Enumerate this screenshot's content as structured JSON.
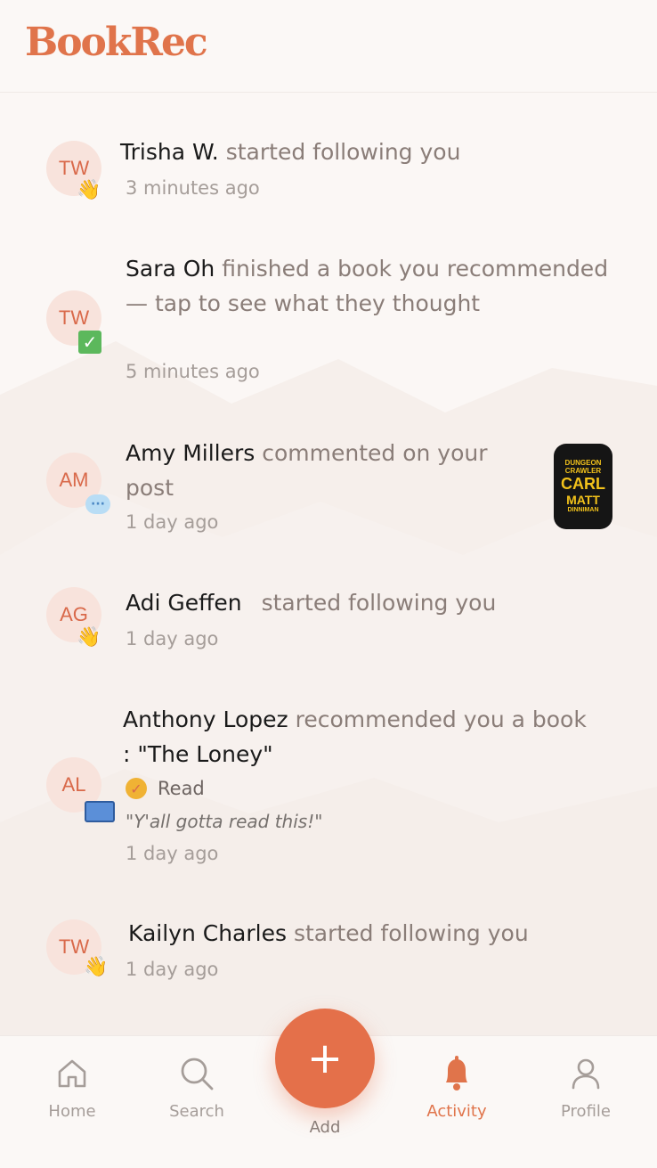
{
  "app": {
    "logo": "BookRec"
  },
  "colors": {
    "accent": "#e0744b",
    "background": "#fbf7f5",
    "avatar_bg": "#f8e3dc"
  },
  "activity": [
    {
      "initials": "TW",
      "badge": "wave-icon",
      "name": "Trisha W.",
      "action": "started following you",
      "time": "3 minutes ago"
    },
    {
      "initials": "TW",
      "badge": "check-icon",
      "name": "Sara Oh",
      "action": "finished a book you recommended — tap to see what they thought",
      "time": "5 minutes ago"
    },
    {
      "initials": "AM",
      "badge": "comment-icon",
      "name": "Amy Millers",
      "action": "commented on your post",
      "time": "1 day ago",
      "book_cover": {
        "line1": "DUNGEON CRAWLER",
        "line2": "CARL",
        "line3": "MATT",
        "line4": "DINNIMAN"
      }
    },
    {
      "initials": "AG",
      "badge": "wave-icon",
      "name": "Adi Geffen",
      "action": "started following you",
      "time": "1 day ago"
    },
    {
      "initials": "AL",
      "badge": "book-icon",
      "name": "Anthony Lopez",
      "action": "recommended you a book",
      "book_title": ": \"The Loney\"",
      "status": "Read",
      "quote": "\"Y'all gotta read this!\"",
      "time": "1 day ago"
    },
    {
      "initials": "TW",
      "badge": "wave-icon",
      "name": "Kailyn Charles",
      "action": "started following you",
      "time": "1 day ago"
    }
  ],
  "nav": {
    "home": "Home",
    "search": "Search",
    "add": "Add",
    "add_symbol": "+",
    "activity": "Activity",
    "profile": "Profile",
    "active": "activity"
  }
}
